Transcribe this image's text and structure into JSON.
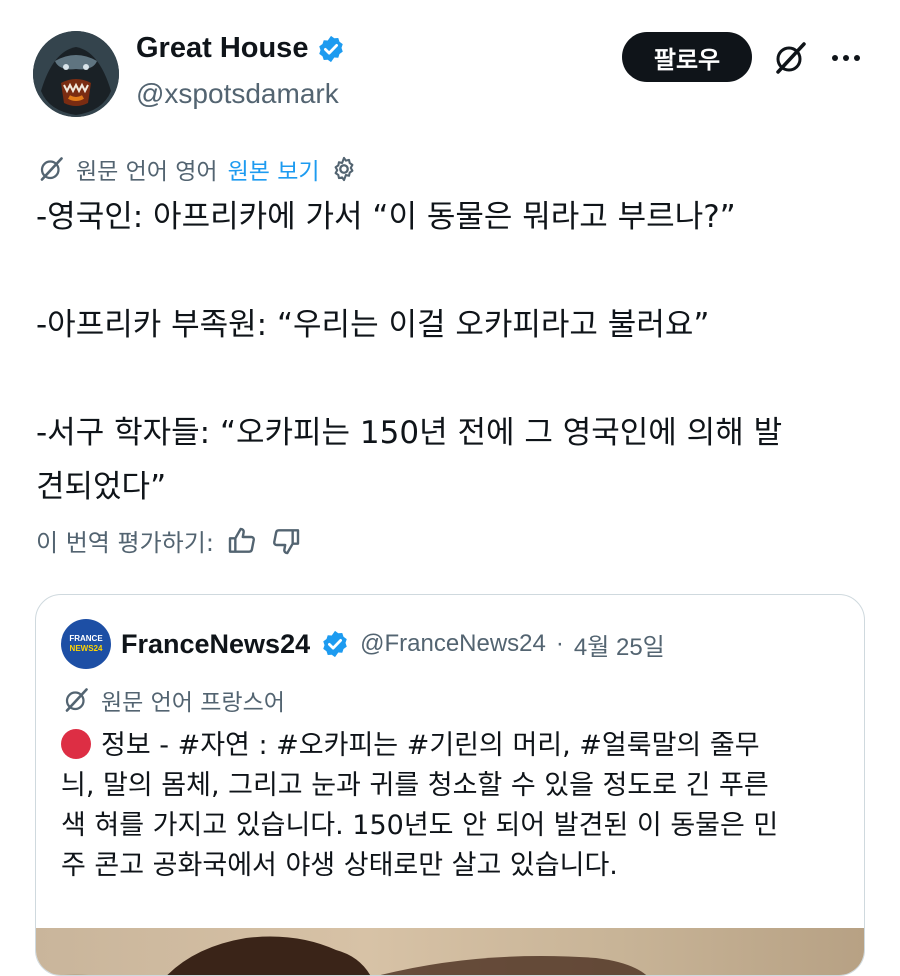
{
  "author": {
    "display_name": "Great House",
    "handle": "@xspotsdamark",
    "avatar_icon": "gorilla-avatar"
  },
  "header": {
    "follow_label": "팔로우"
  },
  "translation": {
    "source_label": "원문 언어 영어",
    "show_original_label": "원본 보기"
  },
  "tweet": {
    "lines": [
      "-영국인: 아프리카에 가서 “이 동물은 뭐라고 부르나?”",
      "",
      "-아프리카 부족원: “우리는 이걸 오카피라고 불러요”",
      "",
      "-서구 학자들: “오카피는 150년 전에 그 영국인에 의해 발",
      "견되었다”"
    ]
  },
  "rating": {
    "label": "이 번역 평가하기:"
  },
  "quote": {
    "display_name": "FranceNews24",
    "handle": "@FranceNews24",
    "separator": "·",
    "date": "4월 25일",
    "avatar_text_top": "FRANCE",
    "avatar_text_bottom": "NEWS24",
    "source_label": "원문 언어 프랑스어",
    "lines": [
      "정보 - #자연 : #오카피는 #기린의 머리, #얼룩말의 줄무",
      "늬, 말의 몸체, 그리고 눈과 귀를 청소할 수 있을 정도로 긴 푸른",
      "색 혀를 가지고 있습니다. 150년도 안 되어 발견된 이 동물은 민",
      "주 콘고 공화국에서 야생 상태로만 살고 있습니다."
    ]
  },
  "colors": {
    "link": "#1d9bf0",
    "verified": "#1d9bf0",
    "muted": "#536471",
    "alert_dot": "#dd2e44"
  }
}
